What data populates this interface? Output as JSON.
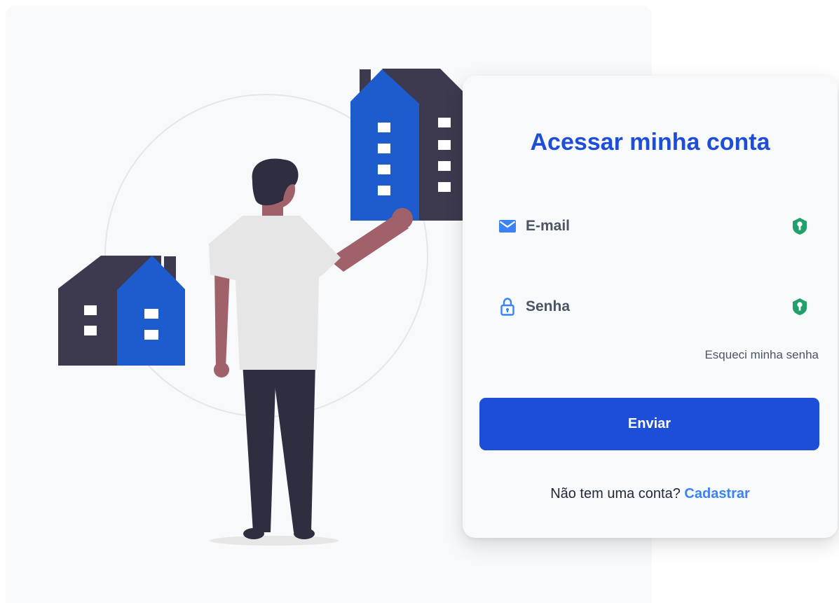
{
  "login": {
    "title": "Acessar minha conta",
    "email_placeholder": "E-mail",
    "password_placeholder": "Senha",
    "forgot_password": "Esqueci minha senha",
    "submit_label": "Enviar",
    "signup_prompt": "Não tem uma conta?",
    "signup_link": "Cadastrar"
  },
  "icons": {
    "email": "envelope-icon",
    "password": "lock-icon",
    "password_manager": "key-shield-icon"
  },
  "colors": {
    "accent": "#1d4ed8",
    "link": "#3b82f6",
    "house_blue": "#1e5bcc",
    "house_dark": "#3d3a4f",
    "key_green": "#22a06b"
  }
}
